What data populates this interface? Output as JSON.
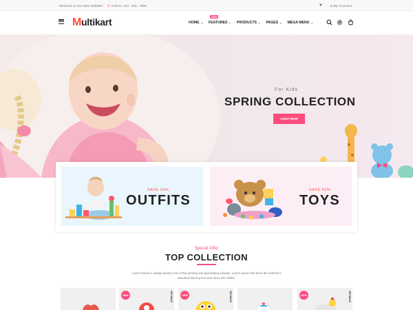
{
  "topbar": {
    "welcome": "Welcome to Our store Multikart",
    "phone": "Call Us: 123 - 456 - 7890",
    "account": "My Account"
  },
  "header": {
    "logo_first": "M",
    "logo_rest": "ultikart",
    "new_tag": "NEW",
    "nav": [
      {
        "label": "HOME"
      },
      {
        "label": "FEATURES"
      },
      {
        "label": "PRODUCTS"
      },
      {
        "label": "PAGES"
      },
      {
        "label": "MEGA MENU"
      }
    ]
  },
  "hero": {
    "subtitle": "For Kids",
    "title": "SPRING COLLECTION",
    "button": "SHOP NOW"
  },
  "categories": {
    "outfits": {
      "save": "SAVE 30%",
      "title": "OUTFITS"
    },
    "toys": {
      "save": "SAVE 60%",
      "title": "TOYS"
    }
  },
  "collection": {
    "special": "Special Offer",
    "title": "TOP COLLECTION",
    "description": "Lorem Ipsum is simply dummy text of the printing and typesetting industry. Lorem Ipsum has been the industry's standard dummy text ever since the 1500s,"
  },
  "products": [
    {
      "new": "",
      "sale": ""
    },
    {
      "new": "NEW",
      "sale": "ON SALE"
    },
    {
      "new": "NEW",
      "sale": "ON SALE"
    },
    {
      "new": "",
      "sale": ""
    },
    {
      "new": "NEW",
      "sale": "ON SALE"
    }
  ],
  "icons": [
    "menu-icon",
    "phone-icon",
    "heart-icon",
    "user-icon",
    "search-icon",
    "gear-icon",
    "cart-icon"
  ],
  "colors": {
    "accent": "#ff4c7c",
    "logo_accent": "#ff4c3b"
  }
}
